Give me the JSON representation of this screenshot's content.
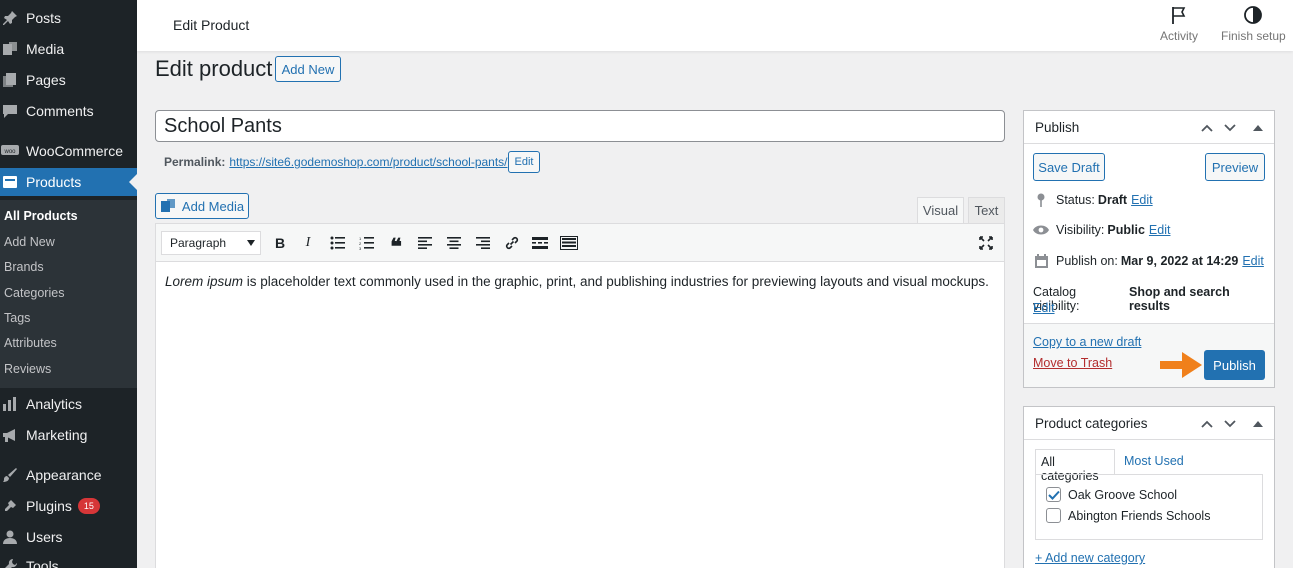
{
  "sidebar": {
    "items": [
      {
        "label": "Posts",
        "icon": "pin-icon"
      },
      {
        "label": "Media",
        "icon": "media-icon"
      },
      {
        "label": "Pages",
        "icon": "pages-icon"
      },
      {
        "label": "Comments",
        "icon": "comment-icon"
      },
      {
        "label": "WooCommerce",
        "icon": "woo-icon"
      },
      {
        "label": "Products",
        "icon": "products-icon"
      },
      {
        "label": "Analytics",
        "icon": "chart-icon"
      },
      {
        "label": "Marketing",
        "icon": "megaphone-icon"
      },
      {
        "label": "Appearance",
        "icon": "brush-icon"
      },
      {
        "label": "Plugins",
        "icon": "plugin-icon",
        "badge": "15"
      },
      {
        "label": "Users",
        "icon": "user-icon"
      },
      {
        "label": "Tools",
        "icon": "wrench-icon"
      }
    ],
    "submenu": [
      "All Products",
      "Add New",
      "Brands",
      "Categories",
      "Tags",
      "Attributes",
      "Reviews"
    ]
  },
  "header": {
    "title": "Edit Product",
    "activity_label": "Activity",
    "finish_setup_label": "Finish setup"
  },
  "page": {
    "heading": "Edit product",
    "add_new_label": "Add New"
  },
  "product": {
    "title": "School Pants",
    "permalink_label": "Permalink:",
    "permalink_url": "https://site6.godemoshop.com/product/school-pants/",
    "permalink_edit": "Edit"
  },
  "editor": {
    "add_media_label": "Add Media",
    "tab_visual": "Visual",
    "tab_text": "Text",
    "format_value": "Paragraph",
    "content_em": "Lorem ipsum",
    "content_rest": " is placeholder text commonly used in the graphic, print, and publishing industries for previewing layouts and visual mockups."
  },
  "publish": {
    "title": "Publish",
    "save_draft": "Save Draft",
    "preview": "Preview",
    "status_label": "Status:",
    "status_value": "Draft",
    "visibility_label": "Visibility:",
    "visibility_value": "Public",
    "publish_on_label": "Publish on:",
    "publish_on_value": "Mar 9, 2022 at 14:29",
    "catalog_label": "Catalog visibility:",
    "catalog_value": "Shop and search results",
    "edit_link": "Edit",
    "copy_draft": "Copy to a new draft",
    "trash": "Move to Trash",
    "publish_button": "Publish"
  },
  "categories": {
    "title": "Product categories",
    "tab_all": "All categories",
    "tab_most_used": "Most Used",
    "items": [
      {
        "label": "Oak Groove School",
        "checked": true
      },
      {
        "label": "Abington Friends Schools",
        "checked": false
      }
    ],
    "add_new": "+ Add new category"
  },
  "colors": {
    "accent": "#2271b1",
    "sidebar_bg": "#1d2327",
    "arrow": "#f0801b",
    "trash": "#b32d2e"
  }
}
